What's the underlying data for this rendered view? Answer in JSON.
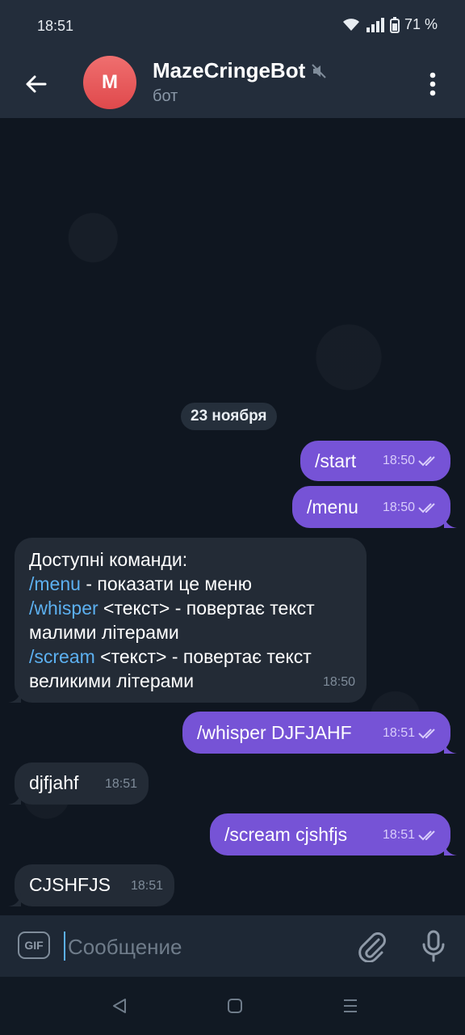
{
  "status": {
    "time": "18:51",
    "battery": "71 %"
  },
  "header": {
    "avatar_letter": "M",
    "title": "MazeCringeBot",
    "subtitle": "бот"
  },
  "chat": {
    "date_chip": "23 ноября",
    "messages": [
      {
        "dir": "out",
        "text": "/start",
        "time": "18:50"
      },
      {
        "dir": "out",
        "text": "/menu",
        "time": "18:50"
      },
      {
        "dir": "in",
        "time": "18:50",
        "lines": [
          {
            "text": "Доступні команди:"
          },
          {
            "cmd": "/menu",
            "rest": " - показати це меню"
          },
          {
            "cmd": "/whisper",
            "rest": " <текст> - повертає текст"
          },
          {
            "text": "малими літерами"
          },
          {
            "cmd": "/scream",
            "rest": " <текст> - повертає текст"
          },
          {
            "text": "великими літерами"
          }
        ]
      },
      {
        "dir": "out",
        "text": "/whisper DJFJAHF",
        "time": "18:51"
      },
      {
        "dir": "in",
        "text": "djfjahf",
        "time": "18:51"
      },
      {
        "dir": "out",
        "text": "/scream cjshfjs",
        "time": "18:51"
      },
      {
        "dir": "in",
        "text": "CJSHFJS",
        "time": "18:51"
      }
    ]
  },
  "composer": {
    "gif_label": "GIF",
    "placeholder": "Сообщение"
  },
  "icons": {
    "back": "arrow-left-icon",
    "mute": "muted-speaker-icon",
    "menu": "more-vertical-icon",
    "attach": "paperclip-icon",
    "mic": "microphone-icon",
    "read": "double-check-icon"
  },
  "colors": {
    "outgoing": "#7653d6",
    "incoming": "#232b36",
    "link": "#5cb0f0",
    "avatar": "#e65557"
  }
}
